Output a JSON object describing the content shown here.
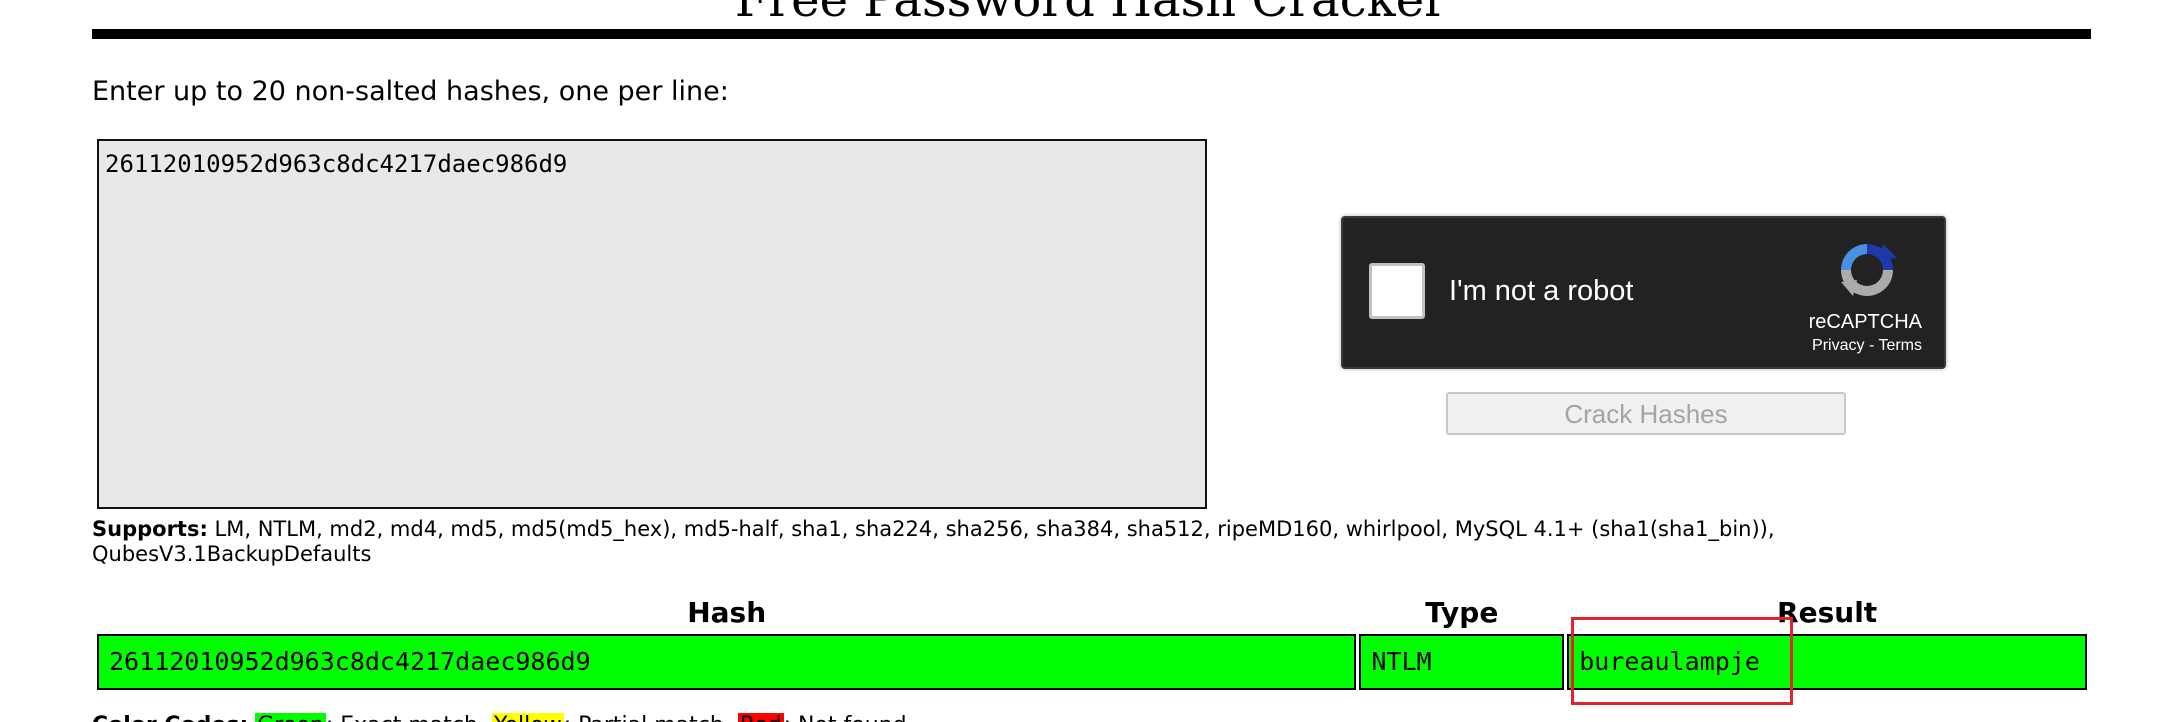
{
  "page": {
    "title": "Free Password Hash Cracker",
    "instructions": "Enter up to 20 non-salted hashes, one per line:"
  },
  "input": {
    "hashes_value": "26112010952d963c8dc4217daec986d9"
  },
  "recaptcha": {
    "label": "I'm not a robot",
    "brand": "reCAPTCHA",
    "privacy": "Privacy",
    "separator": " - ",
    "terms": "Terms"
  },
  "crack_button": {
    "label": "Crack Hashes"
  },
  "supports": {
    "label": "Supports:",
    "text": "LM, NTLM, md2, md4, md5, md5(md5_hex), md5-half, sha1, sha224, sha256, sha384, sha512, ripeMD160, whirlpool, MySQL 4.1+ (sha1(sha1_bin)), QubesV3.1BackupDefaults"
  },
  "results": {
    "headers": {
      "hash": "Hash",
      "type": "Type",
      "result": "Result"
    },
    "rows": [
      {
        "hash": "26112010952d963c8dc4217daec986d9",
        "type": "NTLM",
        "result": "bureaulampje",
        "status_color": "#00ff00"
      }
    ]
  },
  "color_codes": {
    "label": "Color Codes:",
    "green": "Green",
    "green_desc": ": Exact match, ",
    "yellow": "Yellow",
    "yellow_desc": ": Partial match, ",
    "red": "Red",
    "red_desc": ": Not found."
  },
  "colors": {
    "exact_match": "#00ff00",
    "partial_match": "#ffff00",
    "not_found": "#ff0000",
    "highlight_box": "#e3232c"
  }
}
